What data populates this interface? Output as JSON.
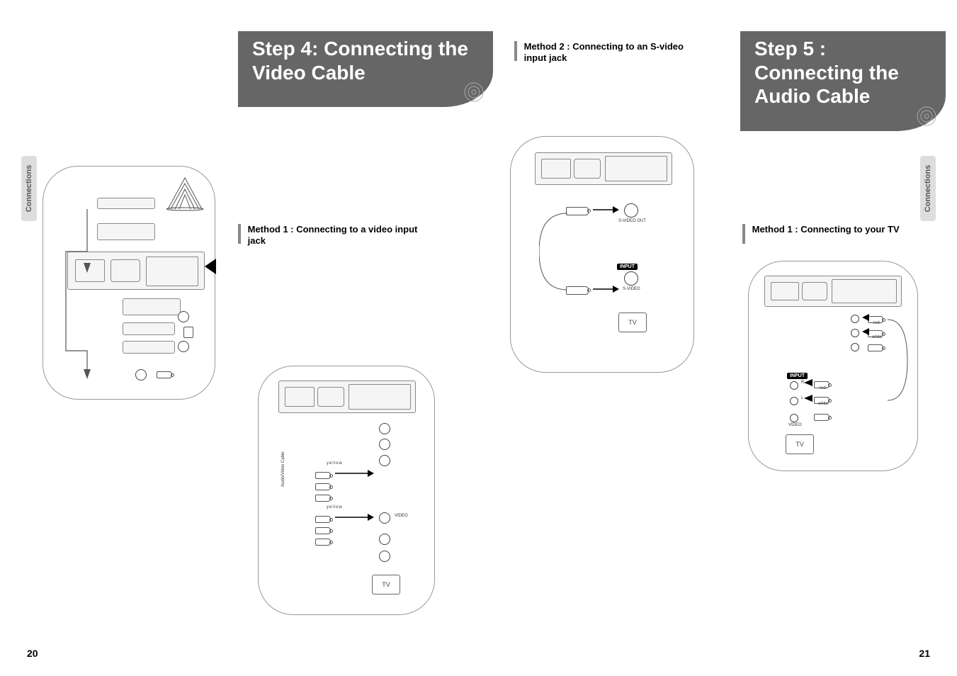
{
  "side_tab": {
    "label": "Connections"
  },
  "sections": {
    "step4": {
      "title": "Step 4: Connecting the Video Cable"
    },
    "step5": {
      "title": "Step 5 : Connecting the Audio Cable"
    }
  },
  "methods": {
    "m1_video": {
      "label": "Method 1 : Connecting to a video input jack"
    },
    "m2_svideo": {
      "label": "Method 2 : Connecting to an S-video input jack"
    },
    "m1_tv": {
      "label": "Method 1 : Connecting to your TV"
    }
  },
  "diagram_labels": {
    "tv": "TV",
    "input": "INPUT",
    "svideo": "S-VIDEO",
    "svideo_out": "S-VIDEO OUT",
    "video": "VIDEO",
    "yellow": "yellow",
    "red": "red",
    "white": "white",
    "av_cable": "Audio/Video Cable",
    "r": "R",
    "l": "L"
  },
  "page_numbers": {
    "left": "20",
    "right": "21"
  }
}
